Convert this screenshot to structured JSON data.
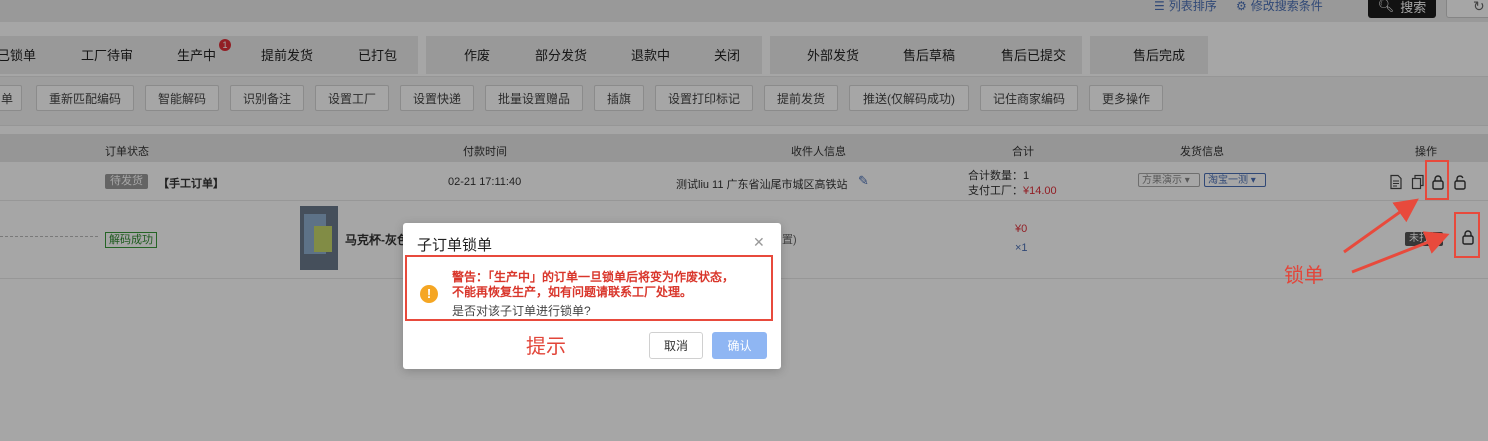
{
  "header": {
    "list_sort": "列表排序",
    "modify_search": "修改搜索条件",
    "search_button": "搜索"
  },
  "tabs": [
    {
      "label": "已锁单"
    },
    {
      "label": "工厂待审"
    },
    {
      "label": "生产中",
      "badge": "1"
    },
    {
      "label": "提前发货"
    },
    {
      "label": "已打包"
    },
    {
      "label": "作废"
    },
    {
      "label": "部分发货"
    },
    {
      "label": "退款中"
    },
    {
      "label": "关闭"
    },
    {
      "label": "外部发货"
    },
    {
      "label": "售后草稿"
    },
    {
      "label": "售后已提交"
    },
    {
      "label": "售后完成"
    }
  ],
  "operations": [
    {
      "label": "单"
    },
    {
      "label": "重新匹配编码"
    },
    {
      "label": "智能解码"
    },
    {
      "label": "识别备注"
    },
    {
      "label": "设置工厂"
    },
    {
      "label": "设置快递"
    },
    {
      "label": "批量设置赠品"
    },
    {
      "label": "插旗"
    },
    {
      "label": "设置打印标记"
    },
    {
      "label": "提前发货"
    },
    {
      "label": "推送(仅解码成功)"
    },
    {
      "label": "记住商家编码"
    },
    {
      "label": "更多操作"
    }
  ],
  "table": {
    "headers": {
      "status": "订单状态",
      "pay_time": "付款时间",
      "receiver": "收件人信息",
      "total": "合计",
      "shipping": "发货信息",
      "actions": "操作"
    }
  },
  "order": {
    "status": "待发货",
    "type": "【手工订单】",
    "pay_time": "02-21 17:11:40",
    "receiver": "测试liu  11  广东省汕尾市城区高铁站",
    "total_qty_label": "合计数量：",
    "total_qty": "1",
    "pay_factory_label": "支付工厂：",
    "pay_factory": "¥14.00",
    "ship_select_1": "方果演示",
    "ship_select_2": "淘宝一测"
  },
  "sub_order": {
    "decode_status": "解码成功",
    "product_name": "马克杯-灰色",
    "receiver_partial": "置)",
    "price": "¥0",
    "qty": "×1",
    "tag": "未打包"
  },
  "modal": {
    "title": "子订单锁单",
    "warning_line1": "警告：「生产中」的订单一旦锁单后将变为作废状态，",
    "warning_line2": "不能再恢复生产，如有问题请联系工厂处理。",
    "question": "是否对该子订单进行锁单?",
    "cancel": "取消",
    "confirm": "确认"
  },
  "annotations": {
    "hint": "提示",
    "lock": "锁单"
  },
  "colors": {
    "annotation_red": "#e84a3c",
    "confirm_blue": "#8fb6f3",
    "warning_orange": "#f5a623",
    "link_blue": "#4a6fb5"
  }
}
